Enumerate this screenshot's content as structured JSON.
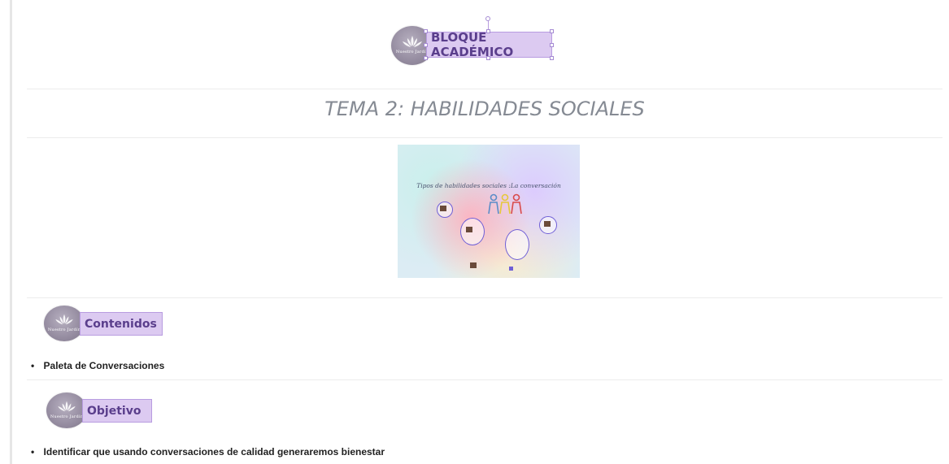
{
  "header": {
    "badge_text": "Nuestro Jardín",
    "label": "BLOQUE ACADÉMICO"
  },
  "topic": {
    "prefix": "TEMA 2:",
    "title": "HABILIDADES SOCIALES"
  },
  "presentation": {
    "thumbnail_title": "Tipos de habilidades sociales :La conversación"
  },
  "sections": [
    {
      "label": "Contenidos",
      "badge_text": "Nuestro Jardín",
      "items": [
        "Paleta de Conversaciones"
      ]
    },
    {
      "label": "Objetivo",
      "badge_text": "Nuestro Jardín",
      "items": [
        "Identificar que usando conversaciones de calidad generaremos bienestar"
      ]
    }
  ],
  "colors": {
    "label_bg": "#dccaf1",
    "label_text": "#5a3e8c",
    "badge": "#978ea2",
    "title_text": "#858a93"
  }
}
